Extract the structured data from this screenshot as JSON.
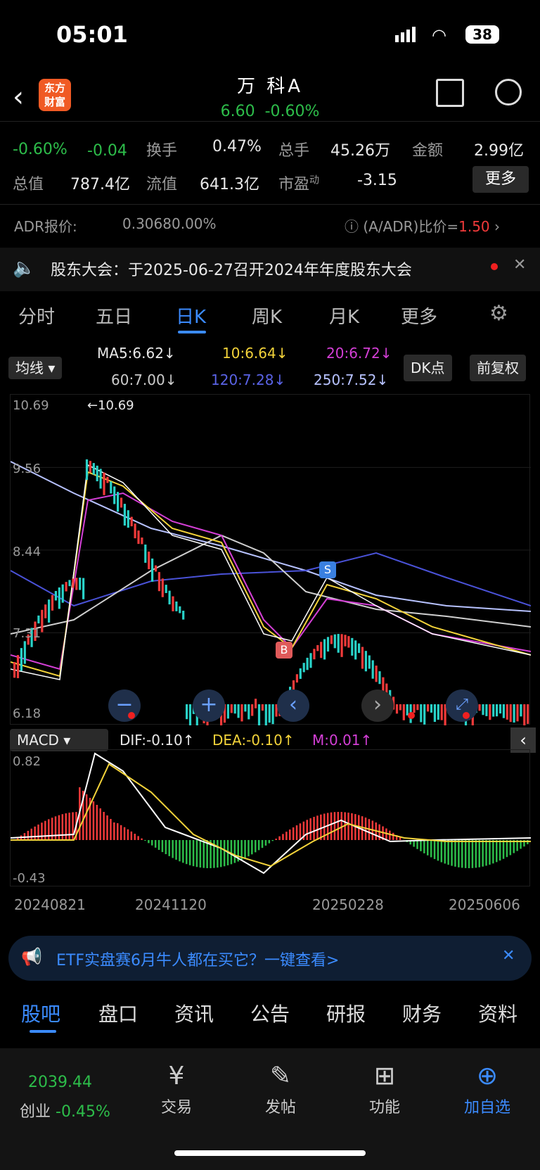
{
  "status_bar": {
    "time": "05:01",
    "battery": "38"
  },
  "header": {
    "logo_text": "东方\n财富",
    "title": "万 科A",
    "price": "6.60",
    "change_pct": "-0.60%"
  },
  "quote": {
    "pct": "-0.60%",
    "chg": "-0.04",
    "turnover_label": "换手",
    "turnover": "0.47%",
    "volume_label": "总手",
    "volume": "45.26万",
    "amount_label": "金额",
    "amount": "2.99亿",
    "mcap_label": "总值",
    "mcap": "787.4亿",
    "float_label": "流值",
    "float": "641.3亿",
    "pe_label": "市盈",
    "pe_sup": "动",
    "pe": "-3.15",
    "more": "更多"
  },
  "adr": {
    "label": "ADR报价:",
    "price": "0.3068",
    "pct": "0.00%",
    "ratio_label": "(A/ADR)比价=",
    "ratio": "1.50"
  },
  "notice": {
    "text": "股东大会：于2025-06-27召开2024年年度股东大会"
  },
  "tabs": [
    "分时",
    "五日",
    "日K",
    "周K",
    "月K",
    "更多"
  ],
  "ma": {
    "selector": "均线",
    "ma5": "MA5:6.62↓",
    "ma10": "10:6.64↓",
    "ma20": "20:6.72↓",
    "ma60": "60:7.00↓",
    "ma120": "120:7.28↓",
    "ma250": "250:7.52↓",
    "dk": "DK点",
    "adjust": "前复权"
  },
  "chart_data": {
    "type": "candlestick",
    "y_ticks": [
      "10.69",
      "9.56",
      "8.44",
      "7.31",
      "6.18"
    ],
    "high_marker": "10.69",
    "low_marker": "6.18",
    "signals": [
      "S",
      "B"
    ],
    "x_ticks": [
      "20240821",
      "20241120",
      "20250228",
      "20250606"
    ],
    "ylim": [
      6.18,
      10.69
    ]
  },
  "macd": {
    "selector": "MACD",
    "dif": "DIF:-0.10↑",
    "dea": "DEA:-0.10↑",
    "m": "M:0.01↑",
    "top": "0.82",
    "bottom": "-0.43"
  },
  "banner": {
    "text": "ETF实盘赛6月牛人都在买它？一键查看>"
  },
  "bottom_tabs": [
    "股吧",
    "盘口",
    "资讯",
    "公告",
    "研报",
    "财务",
    "资料"
  ],
  "nav": {
    "index_value": "2039.44",
    "index_name": "创业",
    "index_pct": "-0.45%",
    "trade": "交易",
    "post": "发帖",
    "func": "功能",
    "add": "加自选"
  },
  "colors": {
    "up": "#f23a3a",
    "down": "#2dbd4a",
    "accent": "#3b8bff"
  }
}
